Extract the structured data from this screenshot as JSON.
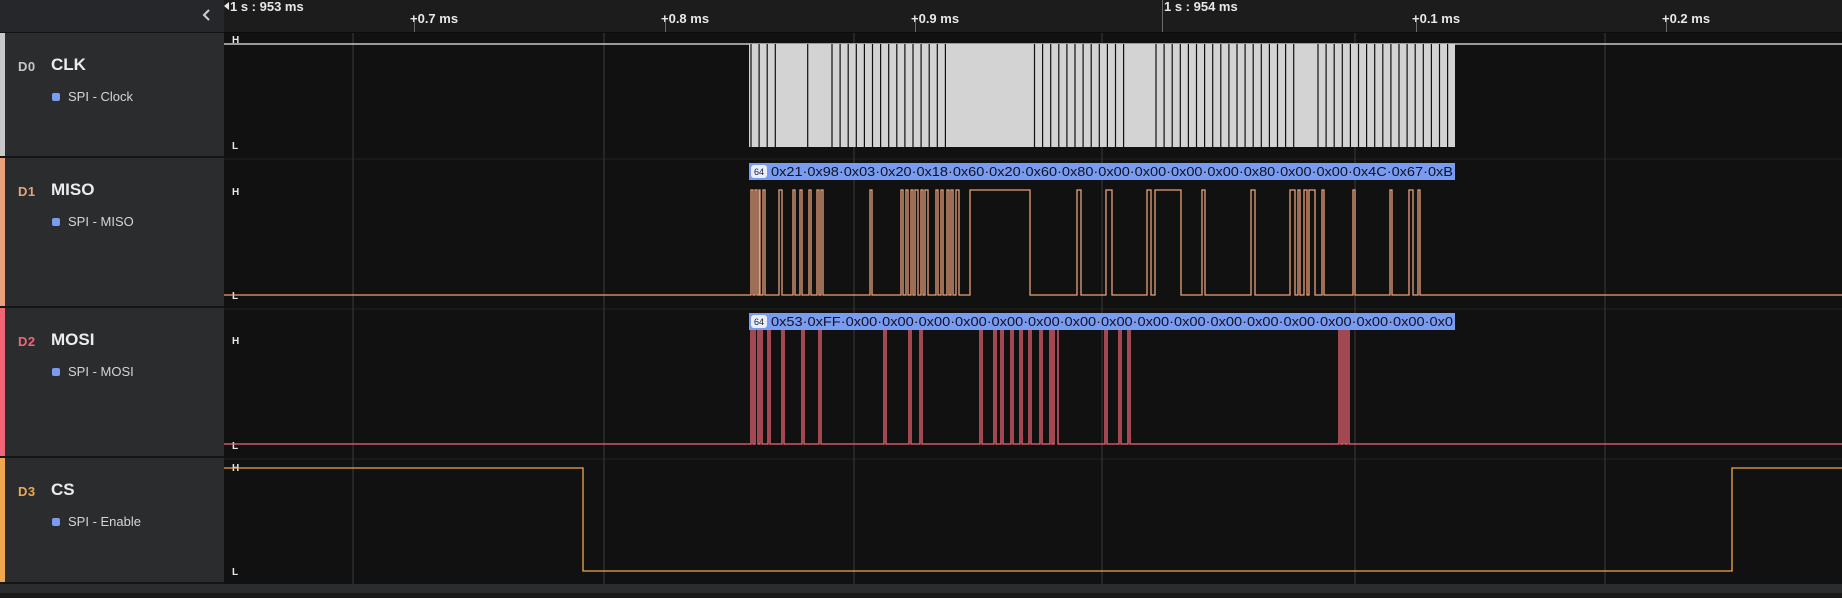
{
  "ruler": {
    "start_marker": "1 s : 953 ms",
    "mid_marker": "1 s : 954 ms",
    "ticks": [
      "+0.7 ms",
      "+0.8 ms",
      "+0.9 ms",
      "+0.1 ms",
      "+0.2 ms"
    ]
  },
  "level_labels": {
    "high": "H",
    "low": "L"
  },
  "channels": [
    {
      "id": "D0",
      "name": "CLK",
      "analyzer": "SPI - Clock",
      "color": "#c8c8c8"
    },
    {
      "id": "D1",
      "name": "MISO",
      "analyzer": "SPI - MISO",
      "color": "#e8a27a"
    },
    {
      "id": "D2",
      "name": "MOSI",
      "analyzer": "SPI - MOSI",
      "color": "#f06676"
    },
    {
      "id": "D3",
      "name": "CS",
      "analyzer": "SPI - Enable",
      "color": "#f0a850"
    }
  ],
  "decoded": {
    "miso": {
      "badge": "64",
      "text": "0x21·0x98·0x03·0x20·0x18·0x60·0x20·0x60·0x80·0x00·0x00·0x00·0x00·0x80·0x00·0x00·0x4C·0x67·0xB"
    },
    "mosi": {
      "badge": "64",
      "text": "0x53·0xFF·0x00·0x00·0x00·0x00·0x00·0x00·0x00·0x00·0x00·0x00·0x00·0x00·0x00·0x00·0x00·0x00·0x0"
    },
    "bubble_color": "#7a9cf0"
  }
}
